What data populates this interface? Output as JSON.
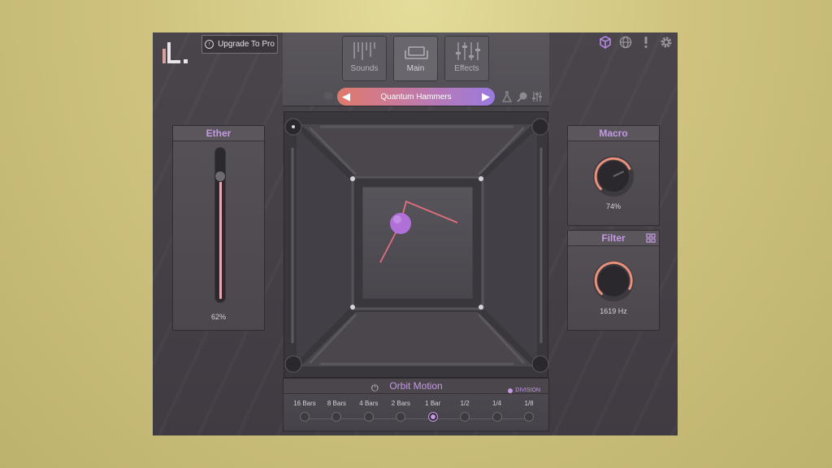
{
  "app": {
    "upgrade_label": "Upgrade To Pro"
  },
  "header_icons": [
    "cube-icon",
    "globe-icon",
    "alert-icon",
    "gear-icon"
  ],
  "tabs": [
    {
      "label": "Sounds",
      "active": false
    },
    {
      "label": "Main",
      "active": true
    },
    {
      "label": "Effects",
      "active": false
    }
  ],
  "preset": {
    "name": "Quantum Hammers"
  },
  "ether": {
    "title": "Ether",
    "value_text": "62%",
    "value": 0.62
  },
  "macro": {
    "title": "Macro",
    "value_text": "74%",
    "value": 0.74
  },
  "filter": {
    "title": "Filter",
    "value_text": "1619 Hz"
  },
  "orbit": {
    "title": "Orbit Motion",
    "division_label": "DIVISION",
    "divisions": [
      "16 Bars",
      "8 Bars",
      "4 Bars",
      "2 Bars",
      "1 Bar",
      "1/2",
      "1/4",
      "1/8"
    ],
    "selected_index": 4
  },
  "colors": {
    "accent": "#c49ae4",
    "arc": "#e8907c",
    "line": "#e2707c"
  }
}
